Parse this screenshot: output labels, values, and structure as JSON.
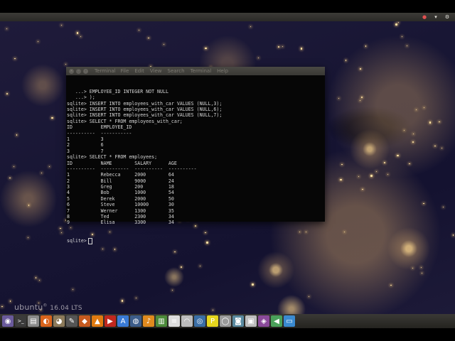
{
  "top_panel": {
    "tray": [
      {
        "icon": "record-icon",
        "glyph": "●"
      },
      {
        "icon": "network-icon",
        "glyph": "▾"
      },
      {
        "icon": "settings-icon",
        "glyph": "⚙"
      }
    ]
  },
  "desktop": {
    "watermark_brand": "ubuntu",
    "watermark_reg": "®",
    "watermark_version": "16.04 LTS"
  },
  "terminal": {
    "app_title": "Terminal",
    "menu": [
      "File",
      "Edit",
      "View",
      "Search",
      "Terminal",
      "Help"
    ],
    "lines": [
      "   ...> EMPLOYEE_ID INTEGER NOT NULL",
      "   ...> );",
      "sqlite> INSERT INTO employees_with_car VALUES (NULL,3);",
      "sqlite> INSERT INTO employees_with_car VALUES (NULL,6);",
      "sqlite> INSERT INTO employees_with_car VALUES (NULL,7);",
      "sqlite> SELECT * FROM employees_with_car;",
      "ID          EMPLOYEE_ID",
      "----------  -----------",
      "1           3",
      "2           6",
      "3           7",
      "sqlite> SELECT * FROM employees;",
      "ID          NAME        SALARY      AGE",
      "----------  ----------  ----------  ----------",
      "1           Rebecca     2000        64",
      "2           Bill        9000        24",
      "3           Greg        200         18",
      "4           Bob         1000        54",
      "5           Derek       2000        50",
      "6           Steve       10000       30",
      "7           Werner      1300        35",
      "8           Ted         2300        34",
      "9           Elisa       3300        34"
    ],
    "prompt": "sqlite>"
  },
  "dock": {
    "items": [
      {
        "icon": "ubuntu-logo-icon",
        "glyph": "◉",
        "color": "#6a5a9c"
      },
      {
        "icon": "terminal-icon",
        "glyph": ">_",
        "color": "#3b3b3b"
      },
      {
        "icon": "files-icon",
        "glyph": "▤",
        "color": "#8a8a8a"
      },
      {
        "icon": "firefox-icon",
        "glyph": "◐",
        "color": "#d9641c"
      },
      {
        "icon": "gimp-icon",
        "glyph": "◕",
        "color": "#8c7a5a"
      },
      {
        "icon": "inkscape-icon",
        "glyph": "✎",
        "color": "#555555"
      },
      {
        "icon": "pitivi-icon",
        "glyph": "◆",
        "color": "#c65a1f"
      },
      {
        "icon": "vlc-icon",
        "glyph": "▲",
        "color": "#e07a10"
      },
      {
        "icon": "youtube-icon",
        "glyph": "▶",
        "color": "#c0281e"
      },
      {
        "icon": "android-studio-icon",
        "glyph": "A",
        "color": "#3a7bd5"
      },
      {
        "icon": "blender-icon",
        "glyph": "◍",
        "color": "#3d5d8a"
      },
      {
        "icon": "audacity-icon",
        "glyph": "♪",
        "color": "#e08a1e"
      },
      {
        "icon": "document-icon",
        "glyph": "▥",
        "color": "#4c8a3a"
      },
      {
        "icon": "text-editor-icon",
        "glyph": "≡",
        "color": "#dcdcdc"
      },
      {
        "icon": "arc-icon",
        "glyph": "◠",
        "color": "#bcbcbc"
      },
      {
        "icon": "chromium-icon",
        "glyph": "◎",
        "color": "#3a6ea5"
      },
      {
        "icon": "pycharm-icon",
        "glyph": "P",
        "color": "#e6d61e"
      },
      {
        "icon": "disk-icon",
        "glyph": "◯",
        "color": "#9a9a9a"
      },
      {
        "icon": "monitor-icon",
        "glyph": "◙",
        "color": "#5a8aa0"
      },
      {
        "icon": "screenshot-icon",
        "glyph": "▣",
        "color": "#bdbdbd"
      },
      {
        "icon": "emulator-icon",
        "glyph": "◈",
        "color": "#8a4a9a"
      },
      {
        "icon": "sound-icon",
        "glyph": "◀",
        "color": "#4aa05a"
      },
      {
        "icon": "network-manager-icon",
        "glyph": "▭",
        "color": "#3a8ad0"
      }
    ]
  }
}
